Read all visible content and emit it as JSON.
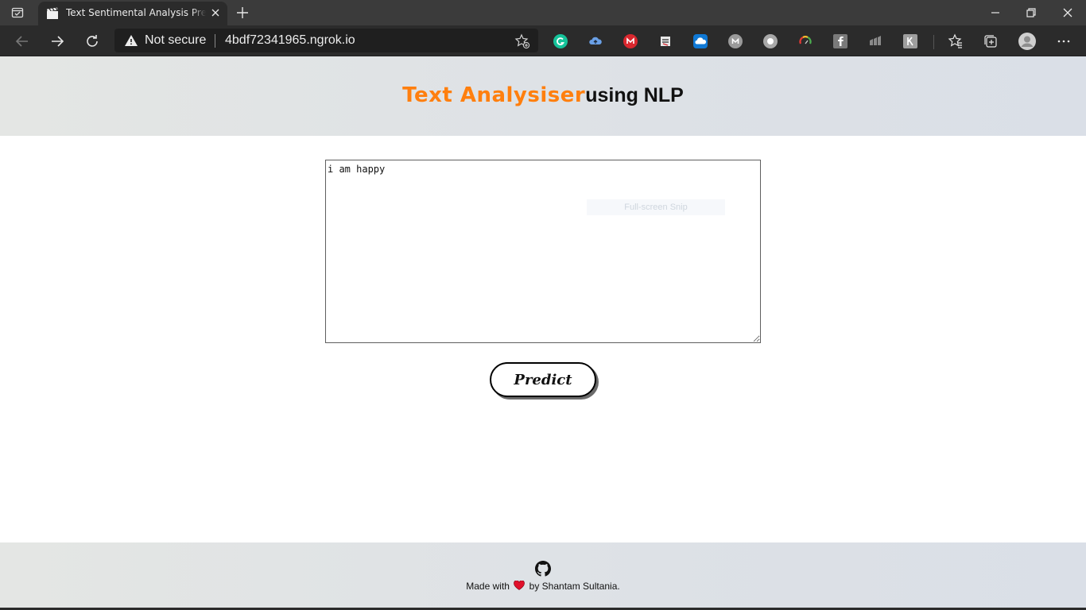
{
  "browser": {
    "tab": {
      "title": "Text Sentimental Analysis Prediction"
    },
    "address_bar": {
      "security_label": "Not secure",
      "url": "4bdf72341965.ngrok.io"
    },
    "icons": {
      "sidebar": "tab-actions-icon",
      "favicon": "clapperboard-icon",
      "close": "close-icon",
      "new_tab": "plus-icon",
      "back": "arrow-left-icon",
      "forward": "arrow-right-icon",
      "reload": "refresh-icon",
      "warning": "warning-triangle-icon",
      "favorite": "star-plus-icon",
      "favorites": "favorites-icon",
      "collections": "collections-icon",
      "profile": "profile-icon",
      "menu": "more-icon"
    },
    "extensions": [
      {
        "name": "grammarly-icon",
        "color": "#15c39a"
      },
      {
        "name": "cloud-upload-icon",
        "color": "#6aa0e6"
      },
      {
        "name": "mega-icon",
        "color": "#d9272e"
      },
      {
        "name": "snip-icon",
        "color": "#e8e8e8"
      },
      {
        "name": "onedrive-icon",
        "color": "#0f78d4"
      },
      {
        "name": "extension-m-icon",
        "color": "#9a9a9a"
      },
      {
        "name": "extension-circle-icon",
        "color": "#a8a8a8"
      },
      {
        "name": "color-wheel-icon",
        "color": "#4caf50"
      },
      {
        "name": "fshare-icon",
        "color": "#7a7a7a"
      },
      {
        "name": "bars-icon",
        "color": "#8a8a8a"
      },
      {
        "name": "k-icon",
        "color": "#9e9e9e"
      }
    ]
  },
  "page": {
    "title_accent": "Text Analysiser",
    "title_rest": "using NLP",
    "accent_color": "#ff7f0e",
    "input_value": "i am happy",
    "snip_hint": "Full-screen Snip",
    "predict_label": "Predict",
    "footer": {
      "made_with": "Made with",
      "by_text": "by Shantam Sultania.",
      "github_icon": "github-icon",
      "heart_icon": "heart-icon"
    }
  }
}
